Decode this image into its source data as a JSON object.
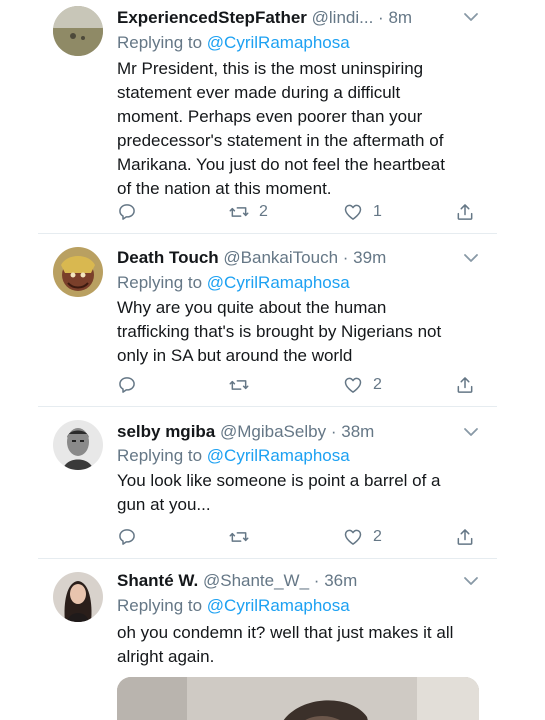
{
  "tweets": [
    {
      "display_name": "ExperiencedStepFather",
      "handle": "@lindi...",
      "dot": "·",
      "time": "8m",
      "replying_prefix": "Replying to",
      "replying_to": "@CyrilRamaphosa",
      "lines": [
        "Mr President, this is the most uninspiring",
        "statement ever made during a difficult",
        "moment. Perhaps even poorer than your",
        "predecessor's statement in the aftermath of",
        "Marikana. You just do not feel the heartbeat",
        "of the nation at this moment."
      ],
      "retweets": "2",
      "likes": "1"
    },
    {
      "display_name": "Death Touch",
      "handle": "@BankaiTouch",
      "dot": "·",
      "time": "39m",
      "replying_prefix": "Replying to",
      "replying_to": "@CyrilRamaphosa",
      "lines": [
        "Why are you quite about the human",
        "trafficking that's is brought by Nigerians not",
        "only in SA but around the world"
      ],
      "retweets": "",
      "likes": "2"
    },
    {
      "display_name": "selby mgiba",
      "handle": "@MgibaSelby",
      "dot": "·",
      "time": "38m",
      "replying_prefix": "Replying to",
      "replying_to": "@CyrilRamaphosa",
      "lines": [
        "You look like someone is point a barrel of a",
        "gun at you..."
      ],
      "retweets": "",
      "likes": "2"
    },
    {
      "display_name": "Shanté W.",
      "handle": "@Shante_W_",
      "dot": "·",
      "time": "36m",
      "replying_prefix": "Replying to",
      "replying_to": "@CyrilRamaphosa",
      "lines": [
        "oh you condemn it? well that just makes it all",
        "alright again."
      ],
      "retweets": "",
      "likes": ""
    }
  ],
  "colors": {
    "text": "#14171a",
    "secondary": "#657786",
    "link": "#1da1f2",
    "divider": "#e6ecf0"
  },
  "icons": {
    "reply": "reply-icon",
    "retweet": "retweet-icon",
    "like": "like-icon",
    "share": "share-icon",
    "caret": "chevron-down-icon"
  }
}
